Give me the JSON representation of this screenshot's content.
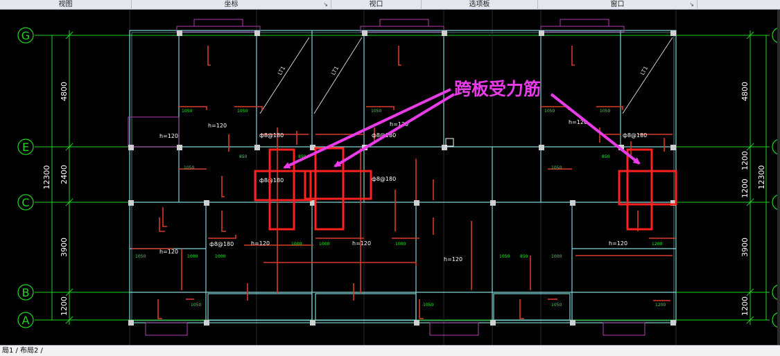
{
  "ribbon": {
    "tabs": [
      {
        "label": "视图"
      },
      {
        "label": "坐标"
      },
      {
        "label": "视口"
      },
      {
        "label": "选项板"
      },
      {
        "label": "窗口"
      }
    ]
  },
  "layout_tabs": [
    "局1 /",
    "布局2 /"
  ],
  "drawing": {
    "annotation": "跨板受力筋",
    "grid_left": [
      "G",
      "E",
      "C",
      "B",
      "A"
    ],
    "dims_left": [
      "4800",
      "2400",
      "3900",
      "1200"
    ],
    "dim_total_left": "12300",
    "dims_right": [
      "4800",
      "1200",
      "1200",
      "3900",
      "1200"
    ],
    "dim_total_right": "12300",
    "slab_labels": [
      "h=120",
      "h=120",
      "h=120",
      "h=120",
      "h=120",
      "h=120",
      "h=120",
      "h=120",
      "h=120"
    ],
    "rebar_labels": [
      "ф8@180",
      "ф8@180",
      "ф8@180",
      "ф8@180",
      "ф8@180",
      "ф8@180"
    ],
    "lt_labels": [
      "LT1",
      "LT1",
      "LT1"
    ],
    "len_labels": [
      "1050",
      "1000",
      "850",
      "1200"
    ],
    "colors": {
      "grid": "#21d421",
      "wall": "#7fd6d6",
      "rebar": "#d83a2a",
      "highlight": "#ff2020",
      "arrow": "#e83ce8",
      "text": "#ffffff",
      "annotation": "#e83ce8",
      "small_text": "#2ee82e"
    }
  }
}
